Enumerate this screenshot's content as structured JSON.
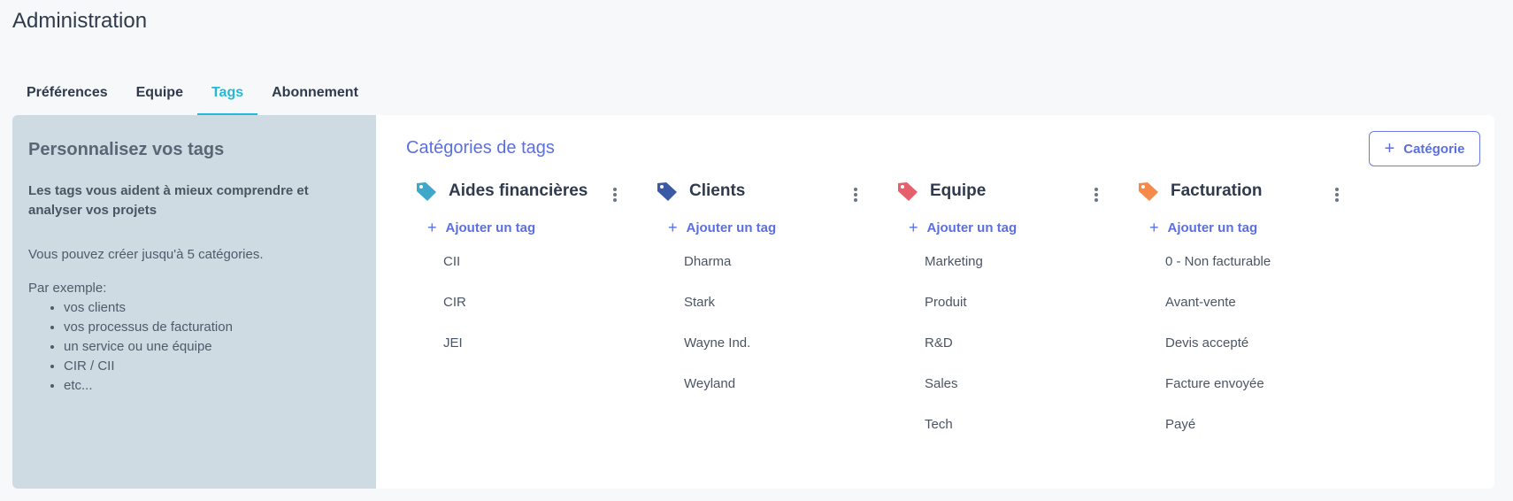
{
  "page_title": "Administration",
  "tabs": [
    {
      "label": "Préférences",
      "active": false
    },
    {
      "label": "Equipe",
      "active": false
    },
    {
      "label": "Tags",
      "active": true
    },
    {
      "label": "Abonnement",
      "active": false
    }
  ],
  "sidebar": {
    "title": "Personnalisez vos tags",
    "intro": "Les tags vous aident à mieux comprendre et analyser vos projets",
    "limit_text": "Vous pouvez créer jusqu'à 5 catégories.",
    "examples_label": "Par exemple:",
    "examples": [
      "vos clients",
      "vos processus de facturation",
      "un service ou une équipe",
      "CIR / CII",
      "etc..."
    ]
  },
  "main": {
    "title": "Catégories de tags",
    "add_category_label": "Catégorie",
    "add_tag_label": "Ajouter un tag",
    "categories": [
      {
        "name": "Aides financières",
        "color": "#3fa7c9",
        "tags": [
          "CII",
          "CIR",
          "JEI"
        ]
      },
      {
        "name": "Clients",
        "color": "#3b5aa6",
        "tags": [
          "Dharma",
          "Stark",
          "Wayne Ind.",
          "Weyland"
        ]
      },
      {
        "name": "Equipe",
        "color": "#e5606c",
        "tags": [
          "Marketing",
          "Produit",
          "R&D",
          "Sales",
          "Tech"
        ]
      },
      {
        "name": "Facturation",
        "color": "#f58a4b",
        "tags": [
          "0 - Non facturable",
          "Avant-vente",
          "Devis accepté",
          "Facture envoyée",
          "Payé"
        ]
      }
    ]
  },
  "colors": {
    "accent": "#26b8d6",
    "primary": "#5c6fe0",
    "sidebar_bg": "#cfdbe2"
  }
}
